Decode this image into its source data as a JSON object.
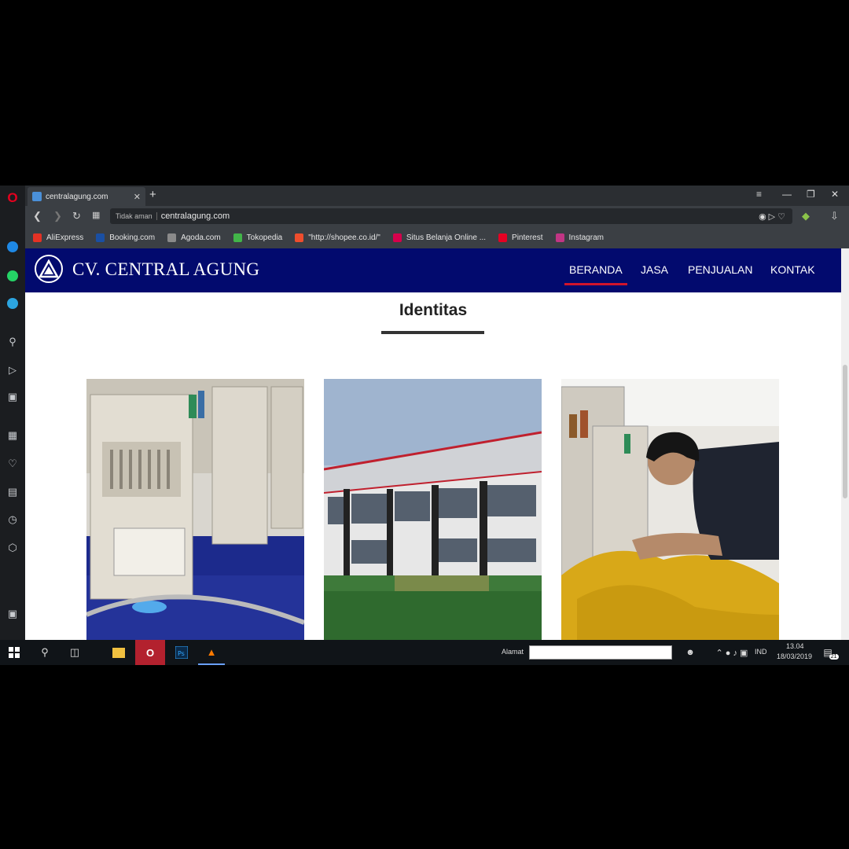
{
  "browser": {
    "tab_title": "centralagung.com",
    "new_tab": "+",
    "security_label": "Tidak aman",
    "url": "centralagung.com",
    "bookmarks": [
      {
        "label": "AliExpress",
        "color": "#e43225"
      },
      {
        "label": "Booking.com",
        "color": "#1a4fa3"
      },
      {
        "label": "Agoda.com",
        "color": "#8a8a8a"
      },
      {
        "label": "Tokopedia",
        "color": "#42b549"
      },
      {
        "label": "\"http://shopee.co.id/\"",
        "color": "#ee4d2d"
      },
      {
        "label": "Situs Belanja Online ...",
        "color": "#d6004c"
      },
      {
        "label": "Pinterest",
        "color": "#e60023"
      },
      {
        "label": "Instagram",
        "color": "#c13584"
      }
    ]
  },
  "site": {
    "brand": "CV. CENTRAL AGUNG",
    "nav": [
      "BERANDA",
      "JASA",
      "PENJUALAN",
      "KONTAK"
    ],
    "active_nav": "BERANDA",
    "section_title": "Identitas",
    "header_color": "#020a6e",
    "accent_color": "#d0142c",
    "photos": [
      "embroidery-machines-photo",
      "factory-building-photo",
      "worker-at-machine-photo"
    ]
  },
  "taskbar": {
    "address_label": "Alamat",
    "language": "IND",
    "time": "13.04",
    "date": "18/03/2019",
    "notification_count": "21"
  }
}
